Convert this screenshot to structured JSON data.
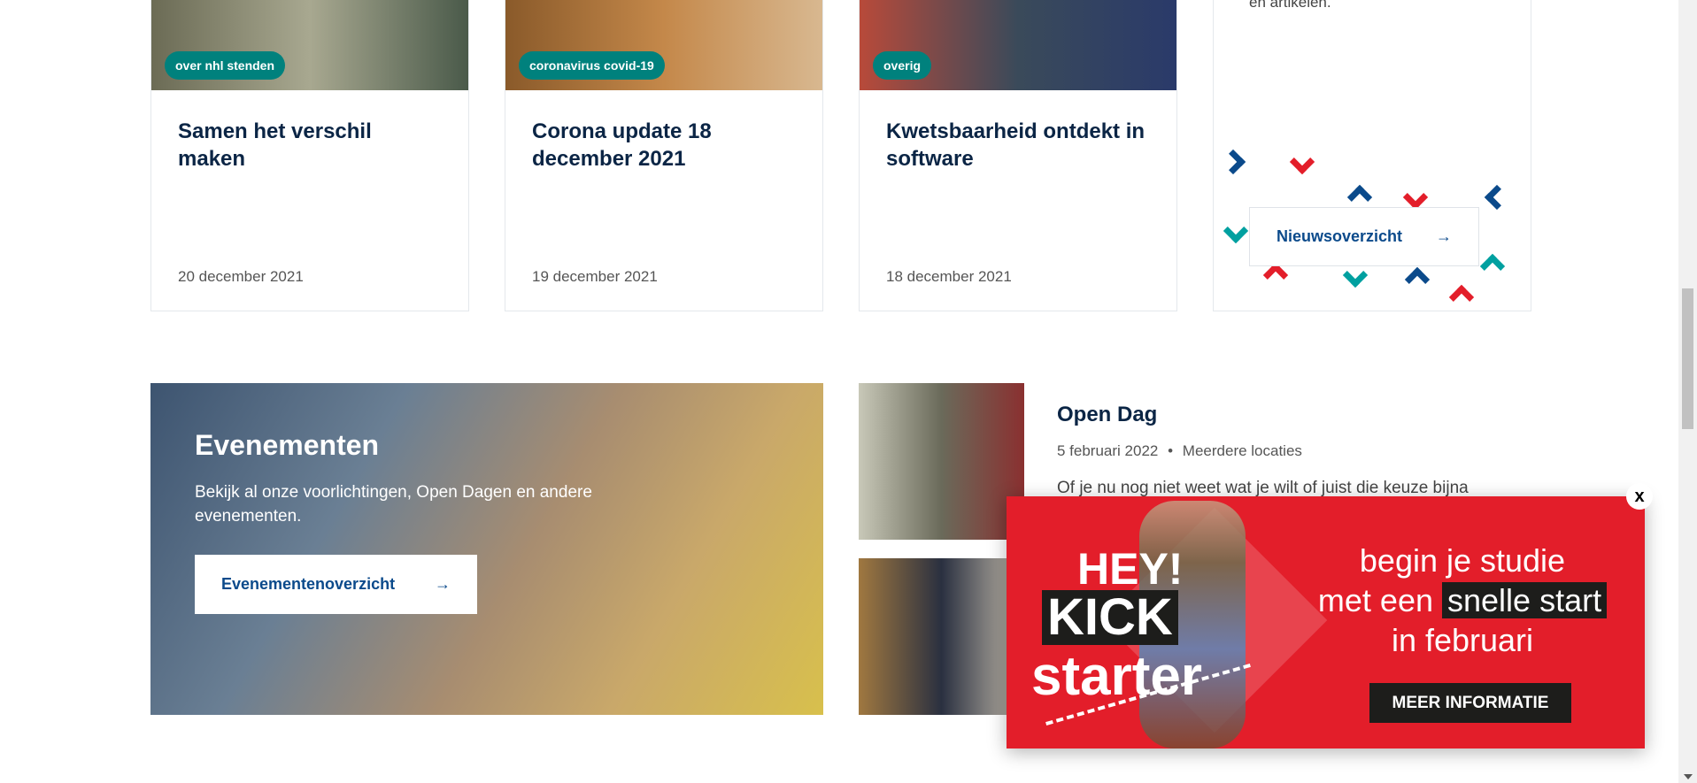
{
  "news": [
    {
      "tag": "over nhl stenden",
      "title": "Samen het verschil maken",
      "date": "20 december 2021"
    },
    {
      "tag": "coronavirus covid-19",
      "title": "Corona update 18 december 2021",
      "date": "19 december 2021"
    },
    {
      "tag": "overig",
      "title": "Kwetsbaarheid ontdekt in software",
      "date": "18 december 2021"
    }
  ],
  "promo": {
    "text": "en artikelen.",
    "button": "Nieuwsoverzicht",
    "arrow": "→"
  },
  "events": {
    "title": "Evenementen",
    "text": "Bekijk al onze voorlichtingen, Open Dagen en andere evenementen.",
    "button": "Evenementenoverzicht",
    "arrow": "→"
  },
  "event_item": {
    "title": "Open Dag",
    "date": "5 februari 2022",
    "separator": "•",
    "location": "Meerdere locaties",
    "text": "Of je nu nog niet weet wat je wilt of juist die keuze bijna"
  },
  "popup": {
    "hey": "HEY!",
    "kick": "KICK",
    "starter": "starter",
    "line1": "begin je studie",
    "line2a": "met een",
    "line2b": "snelle start",
    "line3": "in februari",
    "button": "MEER INFORMATIE",
    "close": "x"
  },
  "colors": {
    "teal": "#00817d",
    "navy": "#0b2545",
    "red": "#e31e2a",
    "blue": "#0b4a8b"
  }
}
